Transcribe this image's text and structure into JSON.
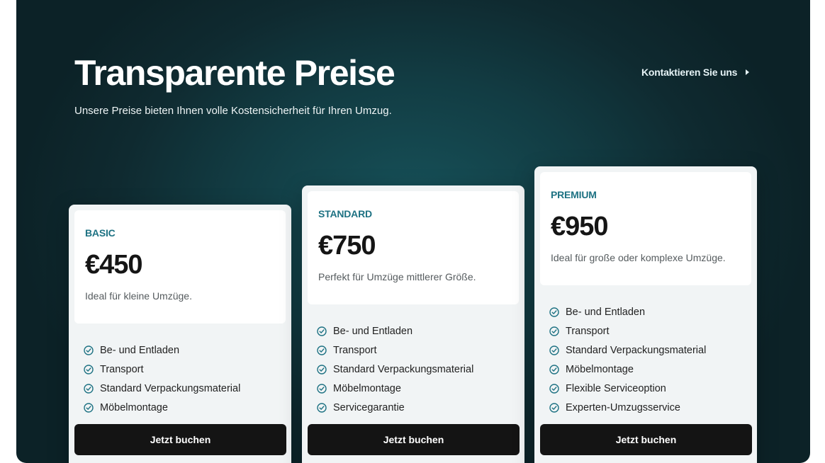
{
  "hero": {
    "title": "Transparente Preise",
    "subtitle": "Unsere Preise bieten Ihnen volle Kostensicherheit für Ihren Umzug.",
    "contact_label": "Kontaktieren Sie uns"
  },
  "colors": {
    "accent": "#1e7283",
    "check": "#1e7283",
    "button": "#141414",
    "background": "#123c43"
  },
  "plans": [
    {
      "tier": "BASIC",
      "price": "€450",
      "description": "Ideal für kleine Umzüge.",
      "features": [
        "Be- und Entladen",
        "Transport",
        "Standard Verpackungsmaterial",
        "Möbelmontage"
      ],
      "button_label": "Jetzt buchen"
    },
    {
      "tier": "STANDARD",
      "price": "€750",
      "description": "Perfekt für Umzüge mittlerer Größe.",
      "features": [
        "Be- und Entladen",
        "Transport",
        "Standard Verpackungsmaterial",
        "Möbelmontage",
        "Servicegarantie"
      ],
      "button_label": "Jetzt buchen"
    },
    {
      "tier": "PREMIUM",
      "price": "€950",
      "description": "Ideal für große oder komplexe Umzüge.",
      "features": [
        "Be- und Entladen",
        "Transport",
        "Standard Verpackungsmaterial",
        "Möbelmontage",
        "Flexible Serviceoption",
        "Experten-Umzugsservice"
      ],
      "button_label": "Jetzt buchen"
    }
  ]
}
